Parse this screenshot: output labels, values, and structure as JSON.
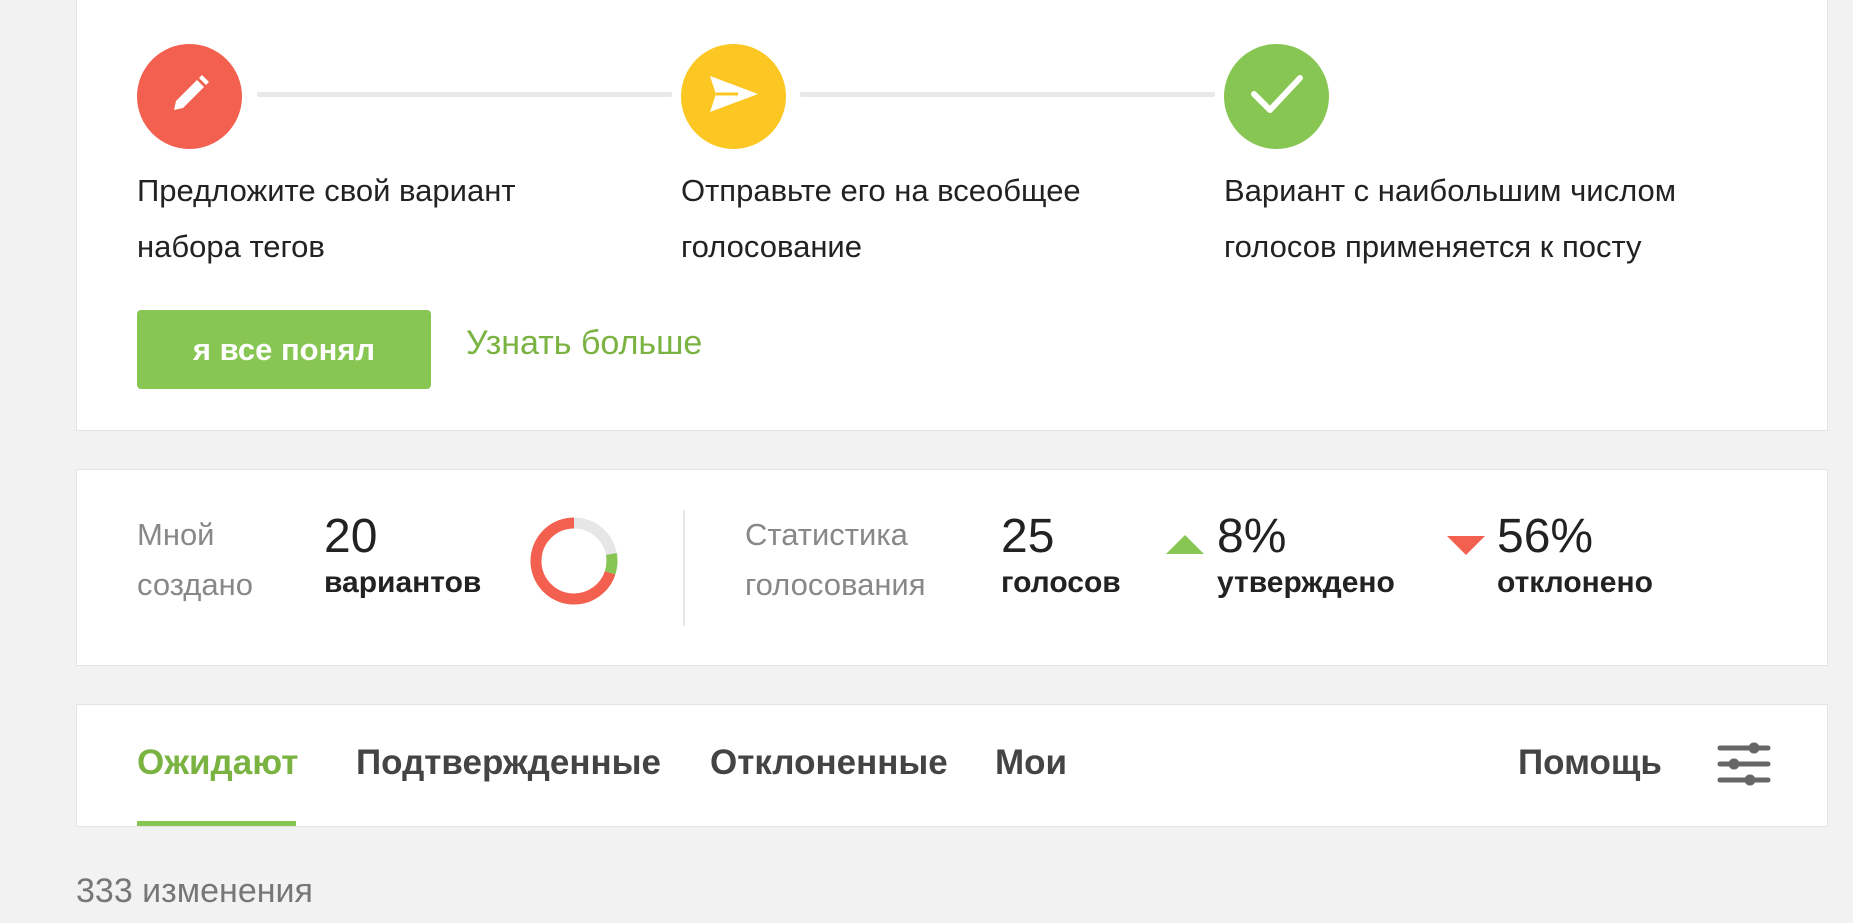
{
  "steps": [
    {
      "text_line1": "Предложите свой вариант",
      "text_line2": "набора тегов",
      "color": "#f4604f",
      "icon": "pencil-icon"
    },
    {
      "text_line1": "Отправьте его на всеобщее",
      "text_line2": "голосование",
      "color": "#fcc722",
      "icon": "send-icon"
    },
    {
      "text_line1": "Вариант с наибольшим числом",
      "text_line2": "голосов применяется к посту",
      "color": "#88c653",
      "icon": "check-icon"
    }
  ],
  "actions": {
    "primary_label": "я все понял",
    "more_label": "Узнать больше"
  },
  "stats": {
    "created_label_1": "Мной",
    "created_label_2": "создано",
    "created_count": "20",
    "created_word": "вариантов",
    "donut_approved_fraction": 0.08,
    "voting_label_1": "Статистика",
    "voting_label_2": "голосования",
    "votes_count": "25",
    "votes_word": "голосов",
    "approved_pct": "8%",
    "approved_word": "утверждено",
    "rejected_pct": "56%",
    "rejected_word": "отклонено"
  },
  "tabs": [
    {
      "label": "Ожидают",
      "active": true
    },
    {
      "label": "Подтвержденные",
      "active": false
    },
    {
      "label": "Отклоненные",
      "active": false
    },
    {
      "label": "Мои",
      "active": false
    }
  ],
  "help_label": "Помощь",
  "changes_count": "333 изменения",
  "colors": {
    "red": "#f4604f",
    "yellow": "#fcc722",
    "green": "#88c653",
    "link_green": "#7ab342"
  }
}
